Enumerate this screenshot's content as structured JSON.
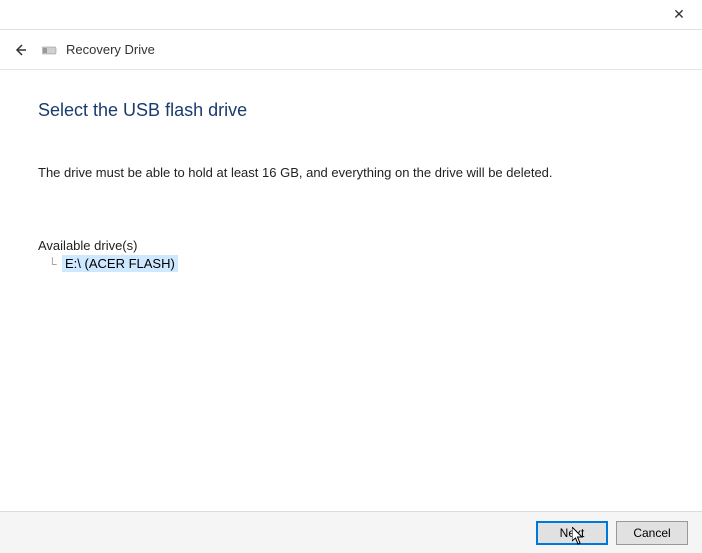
{
  "titlebar": {
    "close_label": "✕"
  },
  "header": {
    "back_label": "←",
    "title": "Recovery Drive"
  },
  "page": {
    "title": "Select the USB flash drive",
    "description": "The drive must be able to hold at least 16 GB, and everything on the drive will be deleted.",
    "section_label": "Available drive(s)",
    "drives": [
      {
        "label": "E:\\ (ACER FLASH)"
      }
    ]
  },
  "footer": {
    "next_label": "Next",
    "cancel_label": "Cancel"
  }
}
